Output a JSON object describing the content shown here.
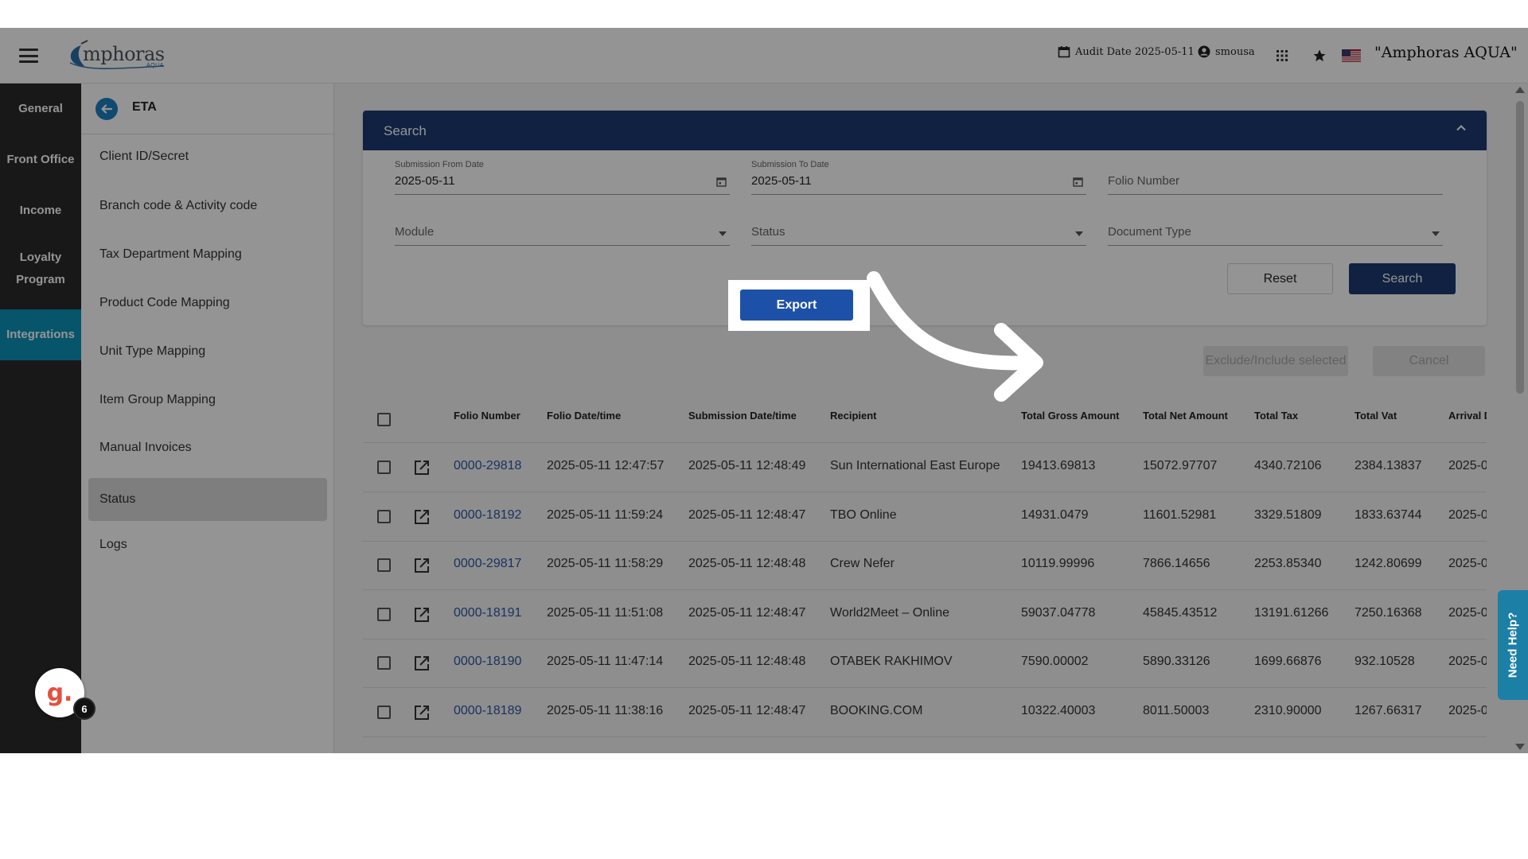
{
  "header": {
    "logo_text": "mphoras",
    "logo_sub": "AQUA",
    "audit_date": "Audit Date 2025-05-11",
    "user": "smousa",
    "property": "\"Amphoras AQUA\""
  },
  "rail": {
    "items": [
      {
        "label": "General"
      },
      {
        "label": "Front Office"
      },
      {
        "label": "Income"
      },
      {
        "label": "Loyalty Program"
      },
      {
        "label": "Integrations",
        "active": true
      }
    ],
    "avatar_letter": "g.",
    "badge_count": "6"
  },
  "submenu": {
    "title": "ETA",
    "items": [
      {
        "label": "Client ID/Secret"
      },
      {
        "label": "Branch code & Activity code"
      },
      {
        "label": "Tax Department Mapping"
      },
      {
        "label": "Product Code Mapping"
      },
      {
        "label": "Unit Type Mapping"
      },
      {
        "label": "Item Group Mapping"
      },
      {
        "label": "Manual Invoices"
      },
      {
        "label": "Status",
        "active": true
      },
      {
        "label": "Logs"
      }
    ]
  },
  "search": {
    "title": "Search",
    "from_label": "Submission From Date",
    "from_value": "2025-05-11",
    "to_label": "Submission To Date",
    "to_value": "2025-05-11",
    "folio_placeholder": "Folio Number",
    "module_placeholder": "Module",
    "status_placeholder": "Status",
    "doctype_placeholder": "Document Type",
    "reset_label": "Reset",
    "search_label": "Search"
  },
  "actions": {
    "export_label": "Export",
    "exclude_label": "Exclude/Include selected",
    "cancel_label": "Cancel"
  },
  "table": {
    "columns": [
      "Folio Number",
      "Folio Date/time",
      "Submission Date/time",
      "Recipient",
      "Total Gross Amount",
      "Total Net Amount",
      "Total Tax",
      "Total Vat",
      "Arrival D"
    ],
    "rows": [
      [
        "0000-29818",
        "2025-05-11 12:47:57",
        "2025-05-11 12:48:49",
        "Sun International East Europe",
        "19413.69813",
        "15072.97707",
        "4340.72106",
        "2384.13837",
        "2025-0"
      ],
      [
        "0000-18192",
        "2025-05-11 11:59:24",
        "2025-05-11 12:48:47",
        "TBO Online",
        "14931.0479",
        "11601.52981",
        "3329.51809",
        "1833.63744",
        "2025-0"
      ],
      [
        "0000-29817",
        "2025-05-11 11:58:29",
        "2025-05-11 12:48:48",
        "Crew Nefer",
        "10119.99996",
        "7866.14656",
        "2253.85340",
        "1242.80699",
        "2025-0"
      ],
      [
        "0000-18191",
        "2025-05-11 11:51:08",
        "2025-05-11 12:48:47",
        "World2Meet – Online",
        "59037.04778",
        "45845.43512",
        "13191.61266",
        "7250.16368",
        "2025-0"
      ],
      [
        "0000-18190",
        "2025-05-11 11:47:14",
        "2025-05-11 12:48:48",
        "OTABEK RAKHIMOV",
        "7590.00002",
        "5890.33126",
        "1699.66876",
        "932.10528",
        "2025-0"
      ],
      [
        "0000-18189",
        "2025-05-11 11:38:16",
        "2025-05-11 12:48:47",
        "BOOKING.COM",
        "10322.40003",
        "8011.50003",
        "2310.90000",
        "1267.66317",
        "2025-0"
      ]
    ]
  },
  "help": {
    "label": "Need Help?"
  },
  "colors": {
    "navy": "#1c3a73",
    "accent": "#0d93b8",
    "link": "#2d57a6",
    "export": "#1d51a8"
  }
}
